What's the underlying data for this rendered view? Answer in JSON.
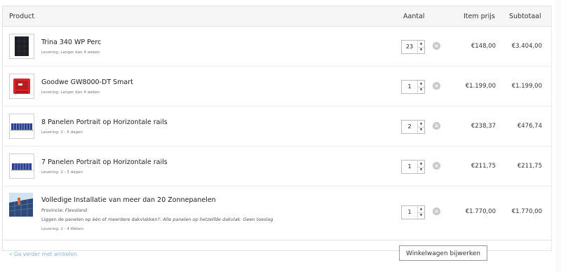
{
  "header": {
    "product": "Product",
    "quantity": "Aantal",
    "item_price": "Item prijs",
    "subtotal": "Subtotaal"
  },
  "items": [
    {
      "name": "Trina 340 WP Perc",
      "delivery": "Levering: Langer dan 4 weken",
      "quantity": "23",
      "price": "€148,00",
      "subtotal": "€3.404,00",
      "thumb_icon": "solar-panel-image"
    },
    {
      "name": "Goodwe GW8000-DT Smart",
      "delivery": "Levering: Langer dan 4 weken",
      "quantity": "1",
      "price": "€1.199,00",
      "subtotal": "€1.199,00",
      "thumb_icon": "inverter-image"
    },
    {
      "name": "8 Panelen Portrait op Horizontale rails",
      "delivery": "Levering: 2 - 5 dagen",
      "quantity": "2",
      "price": "€238,37",
      "subtotal": "€476,74",
      "thumb_icon": "mounting-rails-image"
    },
    {
      "name": "7 Panelen Portrait op Horizontale rails",
      "delivery": "Levering: 2 - 5 dagen",
      "quantity": "1",
      "price": "€211,75",
      "subtotal": "€211,75",
      "thumb_icon": "mounting-rails-image"
    },
    {
      "name": "Volledige Installatie van meer dan 20 Zonnepanelen",
      "province_label": "Provincie:",
      "province_value": "Flevoland",
      "question_label": "Liggen de panelen op één of meerdere dakvlakken?:",
      "question_value": "Alle panelen op hetzelfde dakvlak. Geen toeslag",
      "delivery": "Levering: 2 - 4 Weken",
      "quantity": "1",
      "price": "€1.770,00",
      "subtotal": "€1.770,00",
      "thumb_icon": "installation-photo"
    }
  ],
  "footer": {
    "continue_link": "« Ga verder met winkelen",
    "update_button": "Winkelwagen bijwerken"
  },
  "icons": {
    "remove": "remove-icon",
    "spin_up": "chevron-up-icon",
    "spin_down": "chevron-down-icon"
  },
  "colors": {
    "link": "#8ab7d8",
    "inverter_red": "#d8262c",
    "remove_grey": "#c9c9c9"
  }
}
